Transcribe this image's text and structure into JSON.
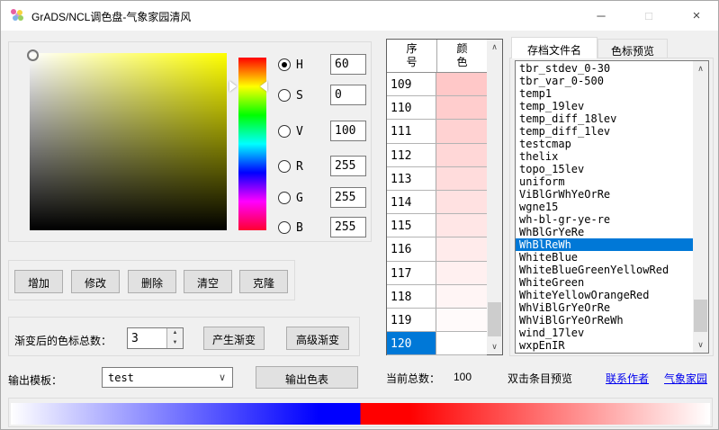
{
  "window": {
    "title": "GrADS/NCL调色盘-气象家园清风"
  },
  "icons": {
    "minimize": "─",
    "maximize": "□",
    "close": "×",
    "dropdown_chevron": "∨",
    "scroll_up": "∧",
    "scroll_down": "∨",
    "spinner_up": "▲",
    "spinner_down": "▼"
  },
  "picker": {
    "channels": [
      {
        "label": "H",
        "value": "60",
        "checked": true
      },
      {
        "label": "S",
        "value": "0",
        "checked": false
      },
      {
        "label": "V",
        "value": "100",
        "checked": false
      },
      {
        "label": "R",
        "value": "255",
        "checked": false
      },
      {
        "label": "G",
        "value": "255",
        "checked": false
      },
      {
        "label": "B",
        "value": "255",
        "checked": false
      }
    ]
  },
  "actions": {
    "add": "增加",
    "modify": "修改",
    "delete": "删除",
    "clear": "清空",
    "clone": "克隆"
  },
  "gradient_section": {
    "label": "渐变后的色标总数：",
    "count": "3",
    "generate_label": "产生渐变",
    "advanced_label": "高级渐变"
  },
  "output_section": {
    "label": "输出模板：",
    "template_value": "test",
    "export_label": "输出色表"
  },
  "color_table": {
    "header_index": "序号",
    "header_color": "颜色",
    "selected": "120",
    "rows": [
      {
        "n": "109",
        "c": "#ffc8c8"
      },
      {
        "n": "110",
        "c": "#ffcdcd"
      },
      {
        "n": "111",
        "c": "#ffd2d2"
      },
      {
        "n": "112",
        "c": "#ffd7d7"
      },
      {
        "n": "113",
        "c": "#ffdcdc"
      },
      {
        "n": "114",
        "c": "#ffe1e1"
      },
      {
        "n": "115",
        "c": "#ffe6e6"
      },
      {
        "n": "116",
        "c": "#ffebeb"
      },
      {
        "n": "117",
        "c": "#fff0f0"
      },
      {
        "n": "118",
        "c": "#fff5f5"
      },
      {
        "n": "119",
        "c": "#fffafa"
      },
      {
        "n": "120",
        "c": "#ffffff"
      }
    ]
  },
  "archive_panel": {
    "tab_files": "存档文件名",
    "tab_preview": "色标预览",
    "selected": "WhBlReWh",
    "files": [
      "tbr_stdev_0-30",
      "tbr_var_0-500",
      "temp1",
      "temp_19lev",
      "temp_diff_18lev",
      "temp_diff_1lev",
      "testcmap",
      "thelix",
      "topo_15lev",
      "uniform",
      "ViBlGrWhYeOrRe",
      "wgne15",
      "wh-bl-gr-ye-re",
      "WhBlGrYeRe",
      "WhBlReWh",
      "WhiteBlue",
      "WhiteBlueGreenYellowRed",
      "WhiteGreen",
      "WhiteYellowOrangeRed",
      "WhViBlGrYeOrRe",
      "WhViBlGrYeOrReWh",
      "wind_17lev",
      "wxpEnIR"
    ]
  },
  "status_bar": {
    "total_label": "当前总数：",
    "total_value": "100",
    "hint": "双击条目预览",
    "link_author": "联系作者",
    "link_home": "气象家园"
  },
  "preview_bar": {
    "colormap": "WhBlReWh",
    "stops": [
      {
        "color": "#ffffff",
        "pos": "0%"
      },
      {
        "color": "#0000ff",
        "pos": "44%"
      },
      {
        "color": "#0000ff",
        "pos": "50%"
      },
      {
        "color": "#ff0000",
        "pos": "50%"
      },
      {
        "color": "#ff0000",
        "pos": "57%"
      },
      {
        "color": "#ffffff",
        "pos": "100%"
      }
    ]
  }
}
